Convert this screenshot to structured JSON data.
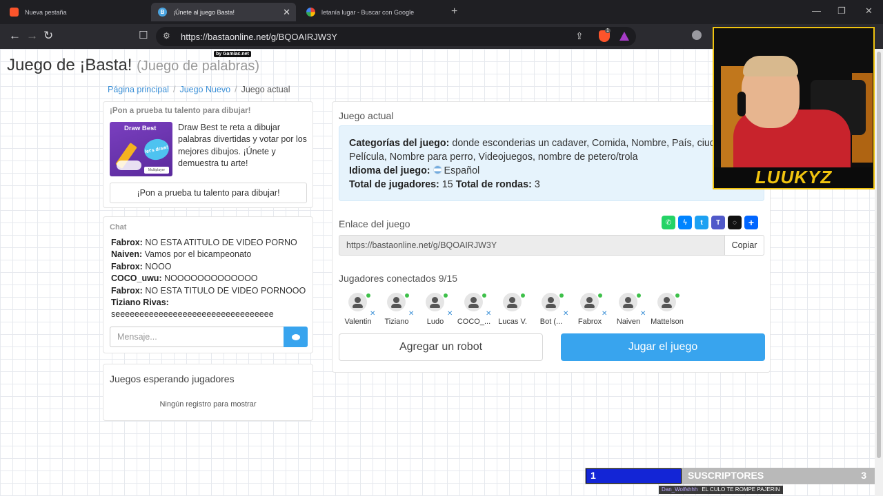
{
  "browser": {
    "tabs": [
      {
        "title": "Nueva pestaña",
        "active": false
      },
      {
        "title": "¡Únete al juego Basta!",
        "active": true
      },
      {
        "title": "letanía lugar - Buscar con Google",
        "active": false
      }
    ],
    "url": "https://bastaonline.net/g/BQOAIRJW3Y",
    "brave_badge": "1"
  },
  "site": {
    "title": "Juego de ¡Basta!",
    "subtitle": "(Juego de palabras)",
    "badge": "by Gamiac.net"
  },
  "breadcrumb": {
    "home": "Página principal",
    "new_game": "Juego Nuevo",
    "current": "Juego actual"
  },
  "promo": {
    "title": "¡Pon a prueba tu talento para dibujar!",
    "image_title": "Draw Best",
    "image_bubble": "let's draw!",
    "image_badge": "Multiplayer",
    "text": "Draw Best te reta a dibujar palabras divertidas y votar por los mejores dibujos. ¡Únete y demuestra tu arte!",
    "button": "¡Pon a prueba tu talento para dibujar!"
  },
  "chat": {
    "title": "Chat",
    "messages": [
      {
        "user": "Fabrox:",
        "text": "NO ESTA ATITULO DE VIDEO PORNO"
      },
      {
        "user": "Naiven:",
        "text": "Vamos por el bicampeonato"
      },
      {
        "user": "Fabrox:",
        "text": "NOOO"
      },
      {
        "user": "COCO_uwu:",
        "text": "NOOOOOOOOOOOOO"
      },
      {
        "user": "Fabrox:",
        "text": "NO ESTA TITULO DE VIDEO PORNOOO"
      },
      {
        "user": "Tiziano Rivas:",
        "text": "seeeeeeeeeeeeeeeeeeeeeeeeeeeeeeeee"
      }
    ],
    "placeholder": "Mensaje..."
  },
  "waiting": {
    "title": "Juegos esperando jugadores",
    "empty": "Ningún registro para mostrar"
  },
  "game": {
    "title": "Juego actual",
    "categories_label": "Categorías del juego:",
    "categories_line1": "donde esconderias un cadaver, Comida, Nombre, País, ciudad,",
    "categories_line2": "Película, Nombre para perro, Videojuegos, nombre de petero/trola",
    "language_label": "Idioma del juego:",
    "language": "Español",
    "players_label": "Total de jugadores:",
    "players_total": "15",
    "rounds_label": "Total de rondas:",
    "rounds_total": "3",
    "link_label": "Enlace del juego",
    "link": "https://bastaonline.net/g/BQOAIRJW3Y",
    "copy": "Copiar",
    "connected_label": "Jugadores conectados 9/15",
    "players": [
      "Valentin",
      "Tiziano",
      "Ludo",
      "COCO_...",
      "Lucas V.",
      "Bot (...",
      "Fabrox",
      "Naiven",
      "Mattelson"
    ],
    "add_robot": "Agregar un robot",
    "play": "Jugar el juego",
    "share_icons": [
      "whatsapp-icon",
      "messenger-icon",
      "twitter-icon",
      "teams-icon",
      "snapchat-icon",
      "share-plus-icon"
    ]
  },
  "stream": {
    "streamer": "LUUKYZ",
    "subs_count": "1",
    "subs_label": "SUSCRIPTORES",
    "subs_goal": "3",
    "subs_progress": 0.33,
    "alert_user": "Dan_Wolfshhh",
    "alert_text": "EL CULO TE ROMPE PAJERIN"
  },
  "colors": {
    "accent": "#38a4ee",
    "link": "#3a8fd6",
    "info_bg": "#e6f3fc",
    "online": "#3ec04a",
    "overlay_yellow": "#f1c40f",
    "subs_blue": "#1325d6"
  }
}
